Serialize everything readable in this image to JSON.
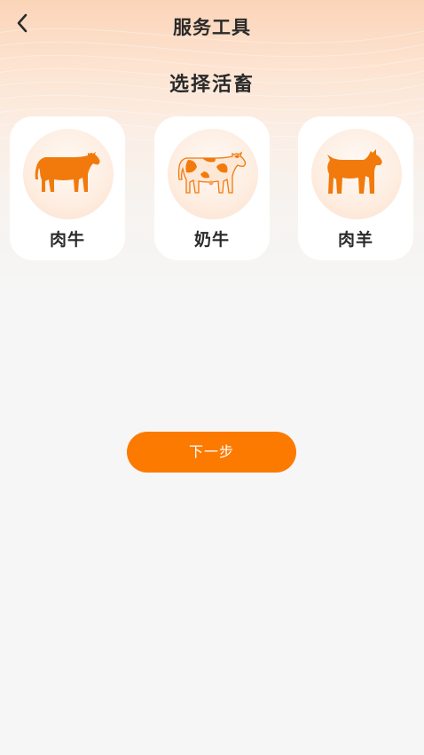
{
  "header": {
    "title": "服务工具",
    "back_icon": "chevron-left-icon"
  },
  "main": {
    "section_title": "选择活畜",
    "animals": [
      {
        "label": "肉牛",
        "icon": "beef-cattle-icon"
      },
      {
        "label": "奶牛",
        "icon": "dairy-cow-icon"
      },
      {
        "label": "肉羊",
        "icon": "goat-icon"
      }
    ],
    "next_button_label": "下一步"
  },
  "colors": {
    "accent": "#fd7a00",
    "icon_orange": "#f27a0c",
    "background": "#f6f6f6",
    "header_gradient_top": "#fbd4b8",
    "text": "#2a2a2a"
  }
}
